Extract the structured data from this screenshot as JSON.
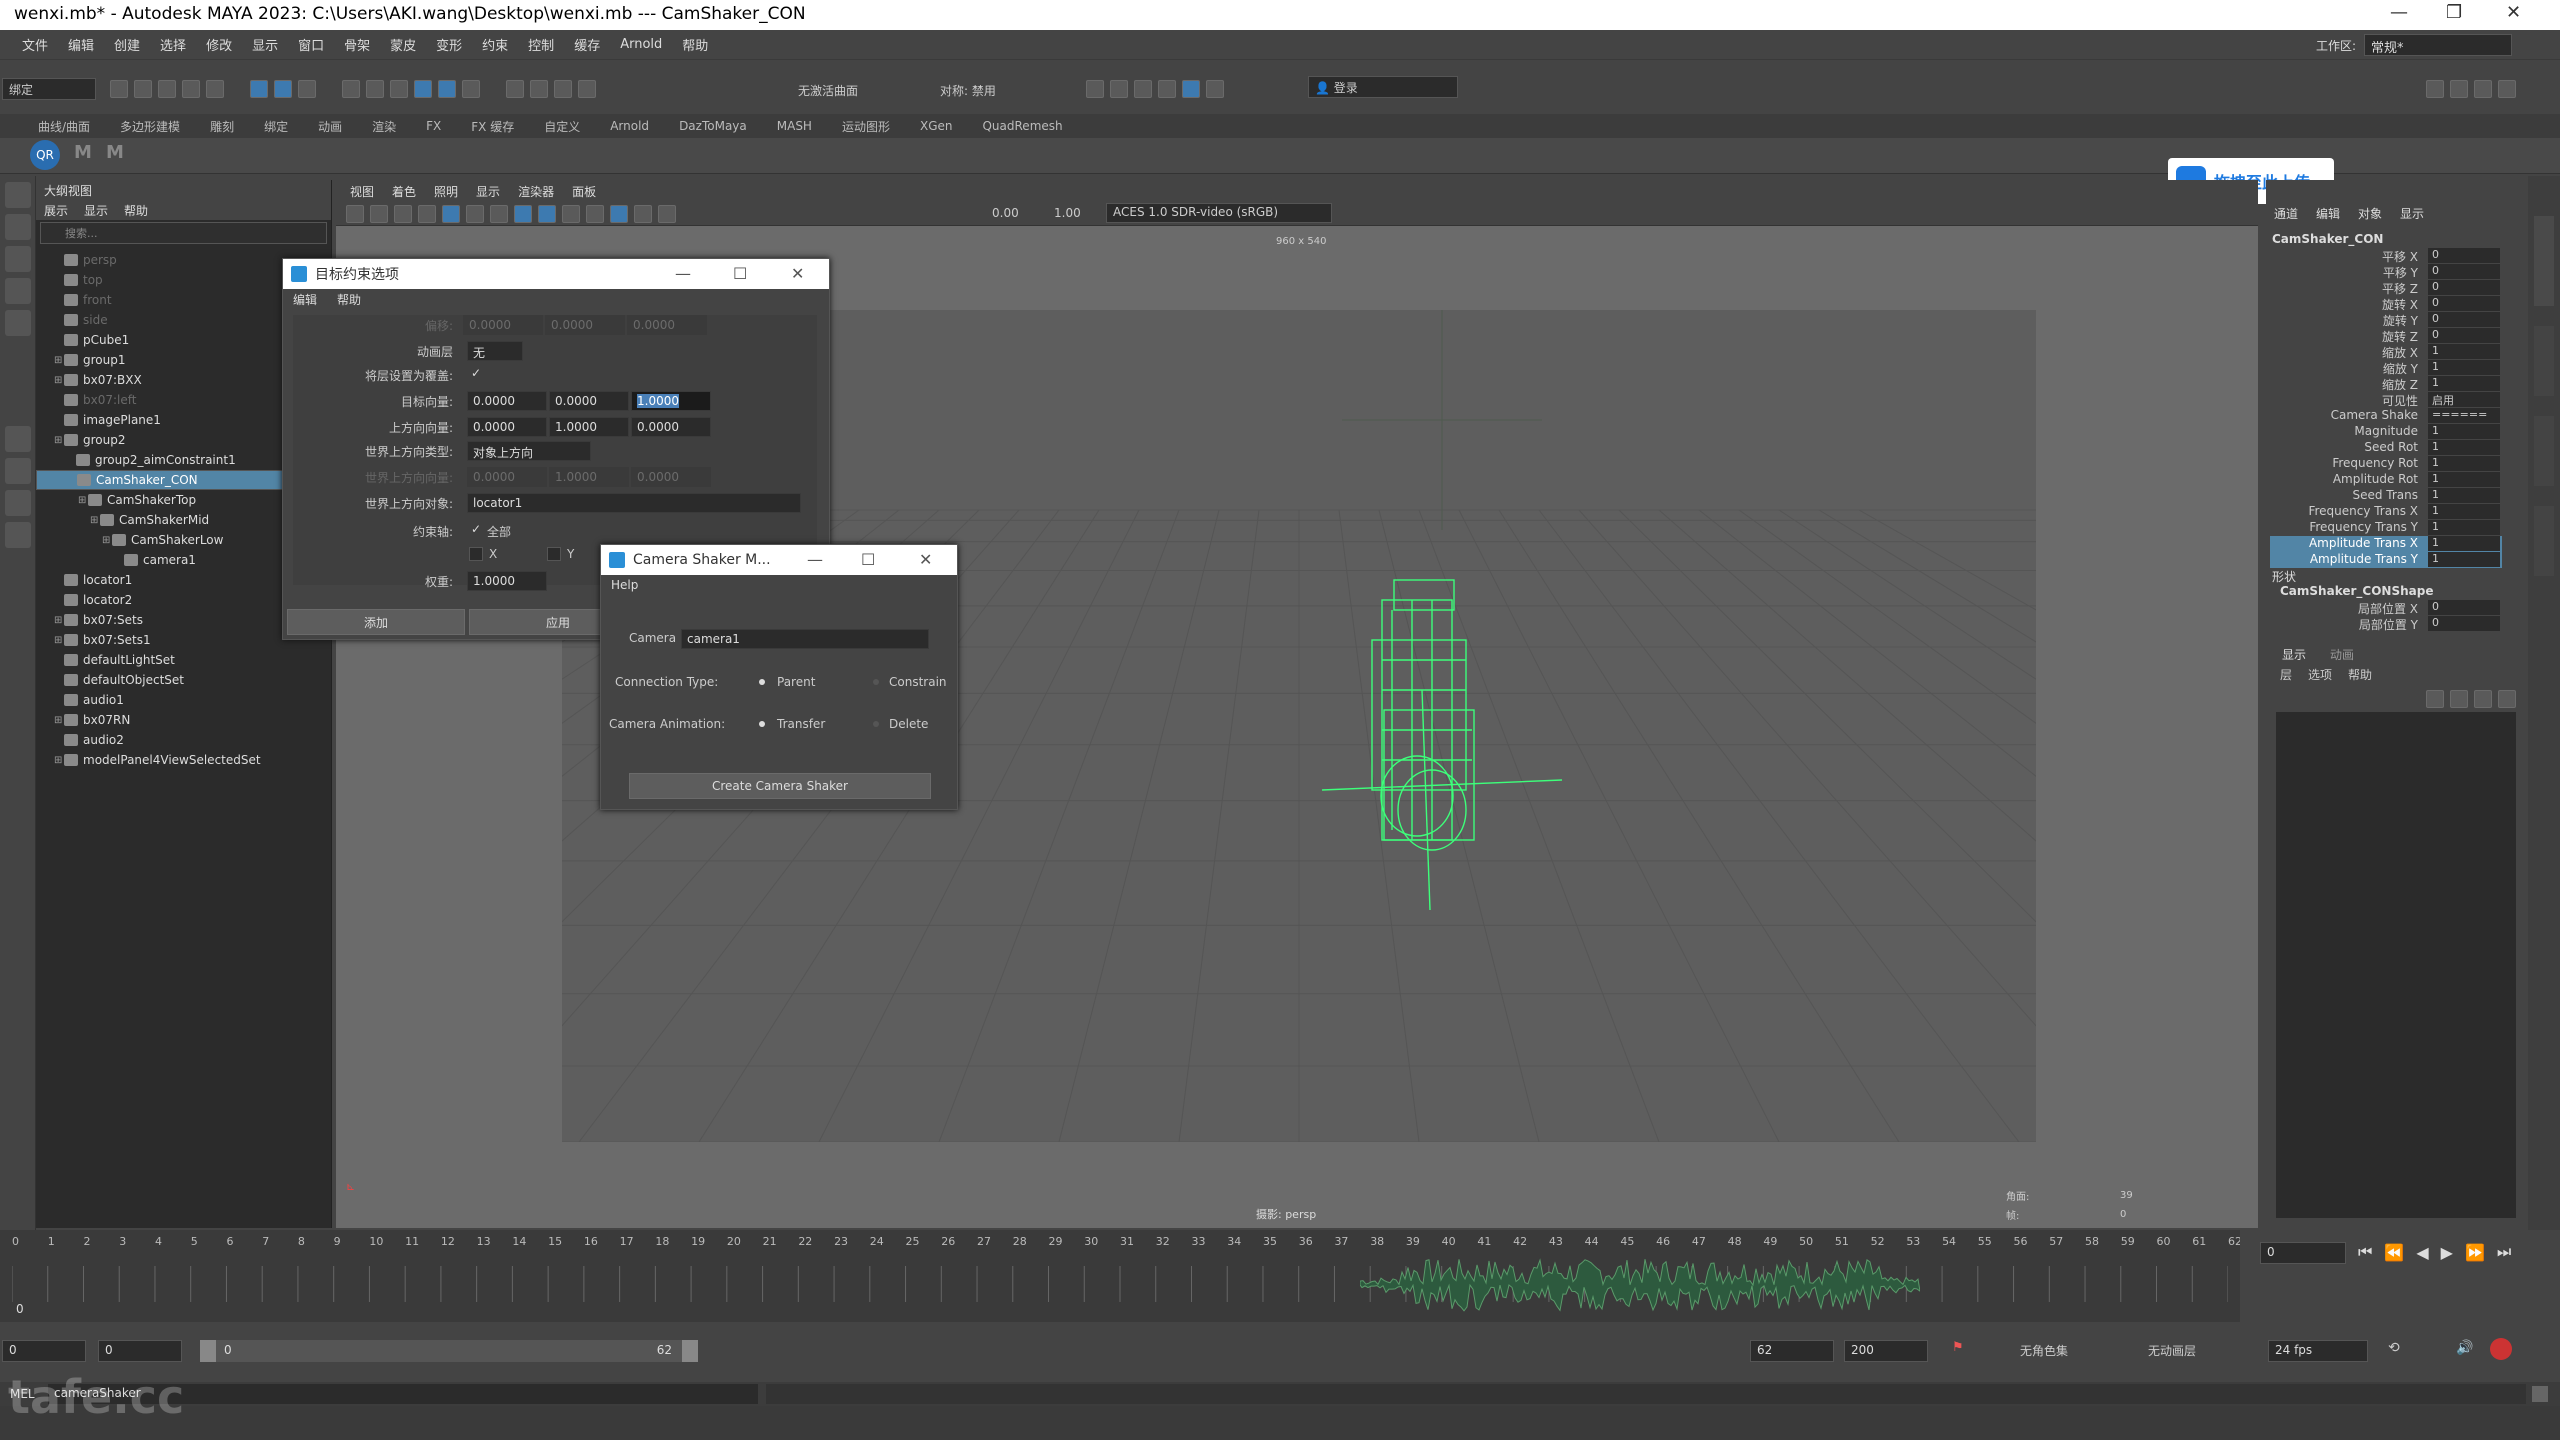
{
  "titlebar": {
    "title": "wenxi.mb* - Autodesk MAYA 2023: C:\\Users\\AKI.wang\\Desktop\\wenxi.mb  ---  CamShaker_CON"
  },
  "menubar": {
    "items": [
      "文件",
      "编辑",
      "创建",
      "选择",
      "修改",
      "显示",
      "窗口",
      "骨架",
      "蒙皮",
      "变形",
      "约束",
      "控制",
      "缓存",
      "Arnold",
      "帮助"
    ],
    "workspace_label": "工作区:",
    "workspace_value": "常规*"
  },
  "statusline": {
    "mode_select": "绑定",
    "live_surface": "无激活曲面",
    "symmetry": "对称: 禁用",
    "login": "登录"
  },
  "shelf": {
    "tabs": [
      "曲线/曲面",
      "多边形建模",
      "雕刻",
      "绑定",
      "动画",
      "渲染",
      "FX",
      "FX 缓存",
      "自定义",
      "Arnold",
      "DazToMaya",
      "MASH",
      "运动图形",
      "XGen",
      "QuadRemesh"
    ]
  },
  "upload": {
    "label": "拖拽至此上传"
  },
  "outliner": {
    "title": "大纲视图",
    "menus": [
      "展示",
      "显示",
      "帮助"
    ],
    "search_placeholder": "搜索...",
    "items": [
      {
        "label": "persp",
        "indent": 1,
        "dim": true,
        "icon": "camera-icon"
      },
      {
        "label": "top",
        "indent": 1,
        "dim": true,
        "icon": "camera-icon"
      },
      {
        "label": "front",
        "indent": 1,
        "dim": true,
        "icon": "camera-icon"
      },
      {
        "label": "side",
        "indent": 1,
        "dim": true,
        "icon": "camera-icon"
      },
      {
        "label": "pCube1",
        "indent": 1,
        "icon": "mesh-icon"
      },
      {
        "label": "group1",
        "indent": 1,
        "expand": true,
        "icon": "group-icon"
      },
      {
        "label": "bx07:BXX",
        "indent": 1,
        "expand": true,
        "icon": "group-icon"
      },
      {
        "label": "bx07:left",
        "indent": 1,
        "dim": true,
        "icon": "group-icon"
      },
      {
        "label": "imagePlane1",
        "indent": 1,
        "icon": "image-plane-icon"
      },
      {
        "label": "group2",
        "indent": 1,
        "expand": true,
        "icon": "group-icon"
      },
      {
        "label": "group2_aimConstraint1",
        "indent": 2,
        "icon": "constraint-icon"
      },
      {
        "label": "CamShaker_CON",
        "indent": 2,
        "selected": true,
        "icon": "locator-icon"
      },
      {
        "label": "CamShakerTop",
        "indent": 3,
        "expand": true,
        "icon": "locator-icon"
      },
      {
        "label": "CamShakerMid",
        "indent": 4,
        "expand": true,
        "icon": "locator-icon"
      },
      {
        "label": "CamShakerLow",
        "indent": 5,
        "expand": true,
        "icon": "locator-icon"
      },
      {
        "label": "camera1",
        "indent": 6,
        "icon": "camera-icon"
      },
      {
        "label": "locator1",
        "indent": 1,
        "icon": "locator-icon"
      },
      {
        "label": "locator2",
        "indent": 1,
        "icon": "locator-icon"
      },
      {
        "label": "bx07:Sets",
        "indent": 1,
        "expand": true,
        "icon": "set-icon"
      },
      {
        "label": "bx07:Sets1",
        "indent": 1,
        "expand": true,
        "icon": "set-icon"
      },
      {
        "label": "defaultLightSet",
        "indent": 1,
        "icon": "set-icon"
      },
      {
        "label": "defaultObjectSet",
        "indent": 1,
        "icon": "set-icon"
      },
      {
        "label": "audio1",
        "indent": 1,
        "icon": "audio-icon"
      },
      {
        "label": "bx07RN",
        "indent": 1,
        "expand": true,
        "icon": "reference-icon"
      },
      {
        "label": "audio2",
        "indent": 1,
        "icon": "audio-icon"
      },
      {
        "label": "modelPanel4ViewSelectedSet",
        "indent": 1,
        "expand": true,
        "icon": "set-icon"
      }
    ]
  },
  "viewport": {
    "menus": [
      "视图",
      "着色",
      "照明",
      "显示",
      "渲染器",
      "面板"
    ],
    "exposure": "0.00",
    "gamma": "1.00",
    "colorspace": "ACES 1.0 SDR-video (sRGB)",
    "resolution": "960 x 540",
    "camera_label": "摄影: persp",
    "info_labels": [
      "角面:",
      "帧:"
    ],
    "info_values": [
      "39",
      "0"
    ]
  },
  "aim_dialog": {
    "title": "目标约束选项",
    "menus": [
      "编辑",
      "帮助"
    ],
    "offset_label": "偏移:",
    "offset_values": [
      "0.0000",
      "0.0000",
      "0.0000"
    ],
    "anim_layer_label": "动画层",
    "anim_layer_value": "无",
    "set_layer_label": "将层设置为覆盖:",
    "aim_vector_label": "目标向量:",
    "aim_vector": [
      "0.0000",
      "0.0000",
      "1.0000"
    ],
    "up_vector_label": "上方向向量:",
    "up_vector": [
      "0.0000",
      "1.0000",
      "0.0000"
    ],
    "world_up_type_label": "世界上方向类型:",
    "world_up_type": "对象上方向",
    "world_up_vector_label": "世界上方向向量:",
    "world_up_vector": [
      "0.0000",
      "1.0000",
      "0.0000"
    ],
    "world_up_object_label": "世界上方向对象:",
    "world_up_object": "locator1",
    "constraint_axes_label": "约束轴:",
    "axis_all": "全部",
    "axis_x": "X",
    "axis_y": "Y",
    "weight_label": "权重:",
    "weight": "1.0000",
    "add_button": "添加",
    "apply_button": "应用"
  },
  "shaker_dialog": {
    "title": "Camera Shaker M...",
    "menu_help": "Help",
    "camera_label": "Camera",
    "camera_value": "camera1",
    "connection_label": "Connection Type:",
    "connection_options": [
      "Parent",
      "Constrain"
    ],
    "animation_label": "Camera Animation:",
    "animation_options": [
      "Transfer",
      "Delete"
    ],
    "create_button": "Create Camera Shaker"
  },
  "channelbox": {
    "menus": [
      "通道",
      "编辑",
      "对象",
      "显示"
    ],
    "object_name": "CamShaker_CON",
    "channels": [
      {
        "name": "平移 X",
        "value": "0"
      },
      {
        "name": "平移 Y",
        "value": "0"
      },
      {
        "name": "平移 Z",
        "value": "0"
      },
      {
        "name": "旋转 X",
        "value": "0"
      },
      {
        "name": "旋转 Y",
        "value": "0"
      },
      {
        "name": "旋转 Z",
        "value": "0"
      },
      {
        "name": "缩放 X",
        "value": "1"
      },
      {
        "name": "缩放 Y",
        "value": "1"
      },
      {
        "name": "缩放 Z",
        "value": "1"
      },
      {
        "name": "可见性",
        "value": "启用"
      },
      {
        "name": "Camera Shake",
        "value": "======"
      },
      {
        "name": "Magnitude",
        "value": "1"
      },
      {
        "name": "Seed Rot",
        "value": "1"
      },
      {
        "name": "Frequency Rot",
        "value": "1"
      },
      {
        "name": "Amplitude Rot",
        "value": "1"
      },
      {
        "name": "Seed Trans",
        "value": "1"
      },
      {
        "name": "Frequency Trans X",
        "value": "1"
      },
      {
        "name": "Frequency Trans Y",
        "value": "1"
      },
      {
        "name": "Amplitude Trans X",
        "value": "1",
        "highlight": true
      },
      {
        "name": "Amplitude Trans Y",
        "value": "1",
        "highlight": true
      }
    ],
    "shape_header": "形状",
    "shape_name": "CamShaker_CONShape",
    "shape_channels": [
      {
        "name": "局部位置 X",
        "value": "0"
      },
      {
        "name": "局部位置 Y",
        "value": "0"
      }
    ]
  },
  "layers": {
    "tabs": [
      "显示",
      "动画"
    ],
    "menus": [
      "层",
      "选项",
      "帮助"
    ]
  },
  "timeline": {
    "ticks": [
      "0",
      "1",
      "2",
      "3",
      "4",
      "5",
      "6",
      "7",
      "8",
      "9",
      "10",
      "11",
      "12",
      "13",
      "14",
      "15",
      "16",
      "17",
      "18",
      "19",
      "20",
      "21",
      "22",
      "23",
      "24",
      "25",
      "26",
      "27",
      "28",
      "29",
      "30",
      "31",
      "32",
      "33",
      "34",
      "35",
      "36",
      "37",
      "38",
      "39",
      "40",
      "41",
      "42",
      "43",
      "44",
      "45",
      "46",
      "47",
      "48",
      "49",
      "50",
      "51",
      "52",
      "53",
      "54",
      "55",
      "56",
      "57",
      "58",
      "59",
      "60",
      "61",
      "62"
    ],
    "current_frame_field": "0",
    "current_marker": "0"
  },
  "range": {
    "start": "0",
    "inner_start": "0",
    "slider_start": "0",
    "slider_end": "62",
    "end": "62",
    "anim_end": "200",
    "char_set": "无角色集",
    "anim_layer": "无动画层",
    "fps": "24 fps"
  },
  "cmdline": {
    "mode": "MEL",
    "text": "cameraShaker"
  },
  "watermark": {
    "text": "tafe.cc"
  }
}
